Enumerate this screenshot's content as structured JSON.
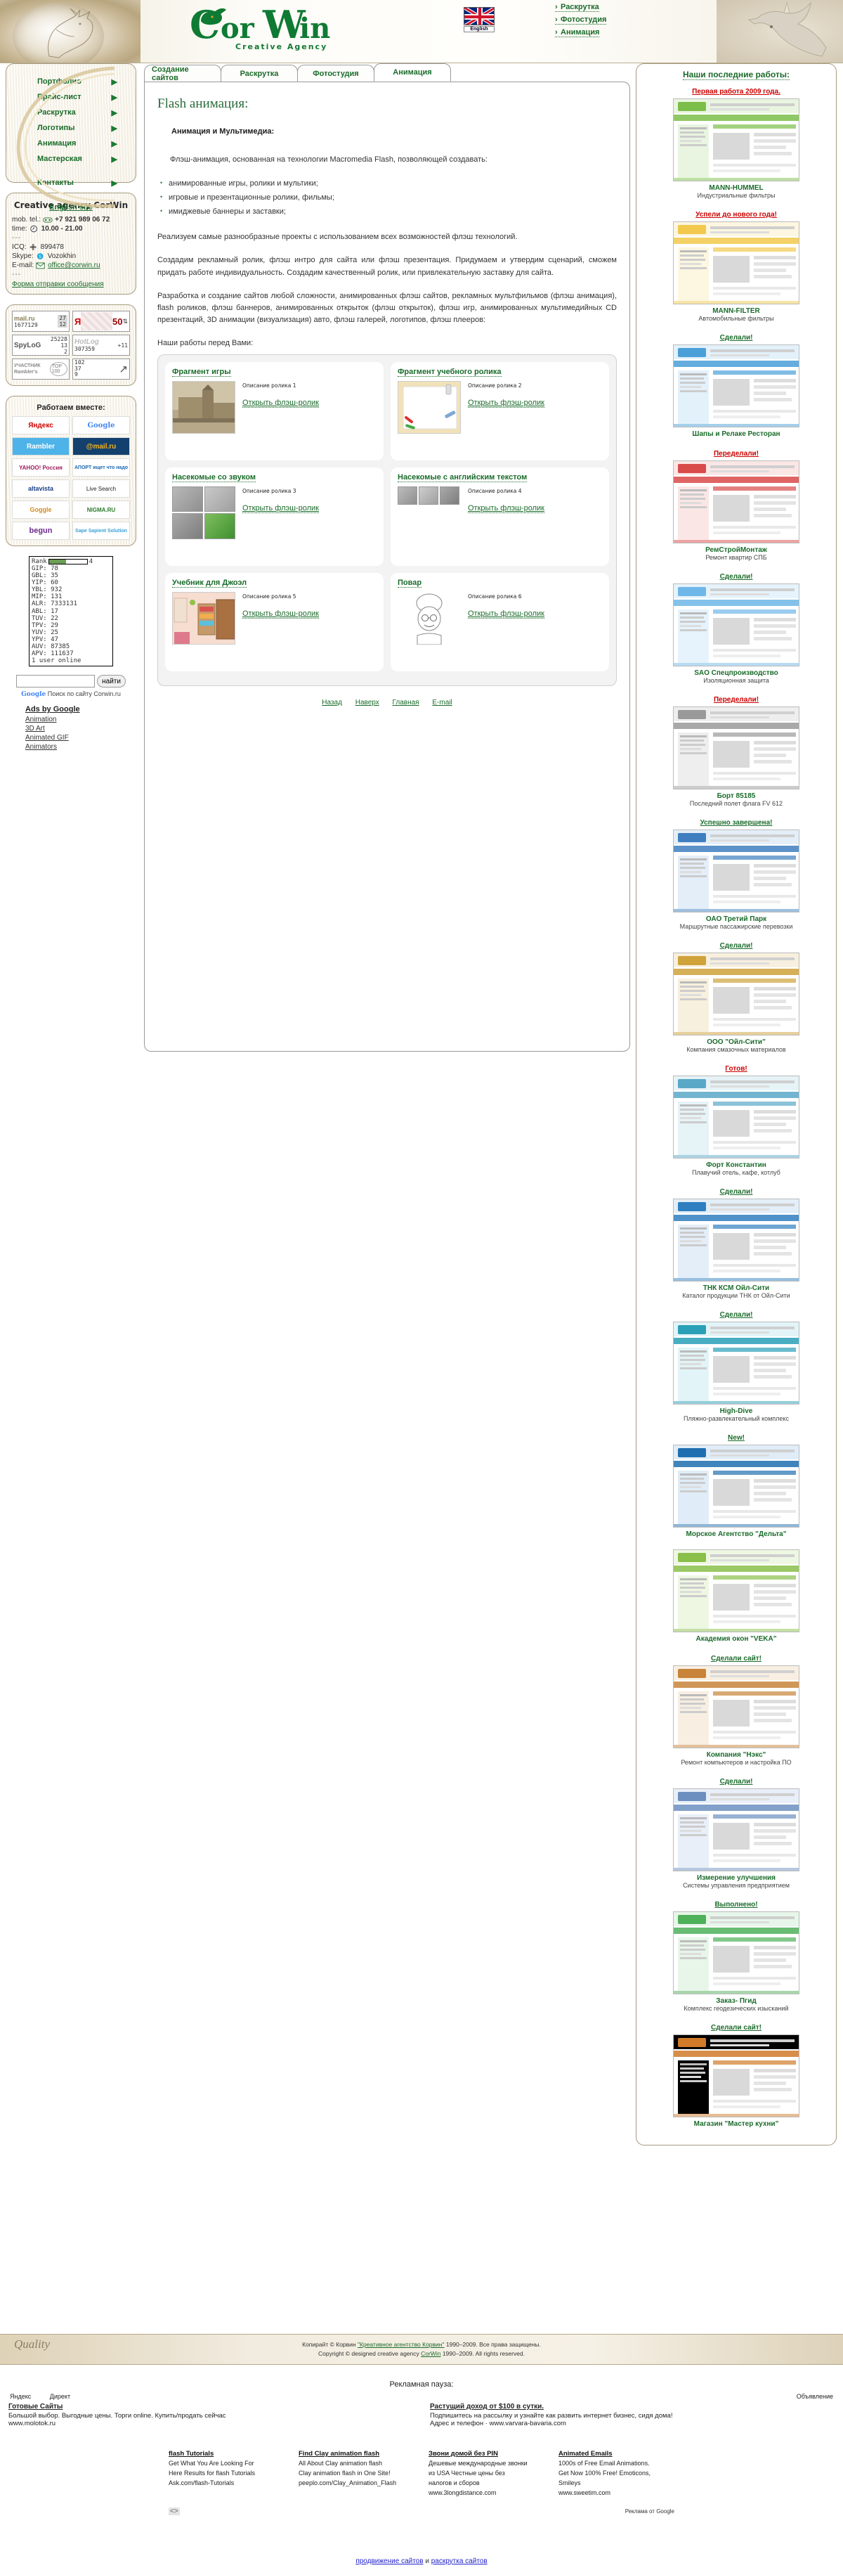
{
  "header": {
    "logo_text": "CorWin",
    "logo_tagline": "Creative Agency",
    "flag_label": "English",
    "nav": [
      {
        "label": "Раскрутка"
      },
      {
        "label": "Фотостудия"
      },
      {
        "label": "Анимация"
      }
    ]
  },
  "sidebar_left": {
    "nav": [
      {
        "label": "Портфолио"
      },
      {
        "label": "Прайс-лист"
      },
      {
        "label": "Раскрутка"
      },
      {
        "label": "Логотипы"
      },
      {
        "label": "Анимация"
      },
      {
        "label": "Мастерская"
      },
      {
        "label": "Контакты"
      }
    ],
    "english_site": "English site",
    "contacts": {
      "title": "Creative agency CorWin",
      "mob_label": "mob. tel.:",
      "mob_value": "+7 921 989 06 72",
      "time_label": "time:",
      "time_value": "10.00 - 21.00",
      "sep": "---",
      "icq_label": "ICQ:",
      "icq_value": "899478",
      "skype_label": "Skype:",
      "skype_value": "Vozokhin",
      "email_label": "E-mail:",
      "email_value": "office@corwin.ru",
      "form_link": "Форма отправки сообщения"
    },
    "counters": [
      {
        "name": "mail-ru-counter",
        "brand": "mail.ru",
        "sub": "1677129",
        "v1": "27",
        "v2": "12"
      },
      {
        "name": "yandex-counter",
        "brand": "Я",
        "sub": "",
        "v1": "50",
        "v2": ""
      },
      {
        "name": "spylog-counter",
        "brand": "SpyLoG",
        "sub": "",
        "v1": "25228",
        "v2": "13",
        "v3": "2"
      },
      {
        "name": "hotlog-counter",
        "brand": "HotLog",
        "sub": "307359",
        "v1": "+11",
        "v2": ""
      },
      {
        "name": "rambler-top100-counter",
        "brand": "УЧАСТНИК Rambler's",
        "sub": "TOP 100",
        "v1": "",
        "v2": ""
      },
      {
        "name": "liveinternet-counter",
        "brand": "",
        "sub": "",
        "v1": "102",
        "v2": "37",
        "v3": "9"
      }
    ],
    "partners": {
      "title": "Работаем вместе:",
      "logos": [
        {
          "label": "Яндекс"
        },
        {
          "label": "Google"
        },
        {
          "label": "Rambler"
        },
        {
          "label": "@mail.ru"
        },
        {
          "label": "YAHOO! Россия"
        },
        {
          "label": "АПОРТ ищет что надо"
        },
        {
          "label": "altavista"
        },
        {
          "label": "Live Search"
        },
        {
          "label": "Goggle"
        },
        {
          "label": "NIGMA.RU"
        },
        {
          "label": "begun"
        },
        {
          "label": "Sape Sapient Solution"
        }
      ]
    },
    "stats": {
      "rank_label": "Rank",
      "rank_value": "4",
      "rank_pct": 45,
      "rows": [
        {
          "k": "GIP:",
          "v": "78"
        },
        {
          "k": "GBL:",
          "v": "35"
        },
        {
          "k": "YIP:",
          "v": "60"
        },
        {
          "k": "YBL:",
          "v": "932"
        },
        {
          "k": "MIP:",
          "v": "131"
        },
        {
          "k": "ALR:",
          "v": "7333131"
        },
        {
          "k": "ABL:",
          "v": "17"
        },
        {
          "k": "TUV:",
          "v": "22"
        },
        {
          "k": "TPV:",
          "v": "29"
        },
        {
          "k": "YUV:",
          "v": "25"
        },
        {
          "k": "YPV:",
          "v": "47"
        },
        {
          "k": "AUV:",
          "v": "87385"
        },
        {
          "k": "APV:",
          "v": "111637"
        }
      ],
      "online": "1 user online"
    },
    "search": {
      "value": "",
      "placeholder": "",
      "button": "найти",
      "google_label": "Google",
      "caption": "Поиск по сайту Corwin.ru"
    },
    "ads": {
      "title": "Ads by Google",
      "links": [
        "Animation",
        "3D Art",
        "Animated GIF",
        "Animators"
      ]
    }
  },
  "main": {
    "tabs": [
      {
        "label": "Создание сайтов",
        "active": false
      },
      {
        "label": "Раскрутка",
        "active": false
      },
      {
        "label": "Фотостудия",
        "active": false
      },
      {
        "label": "Анимация",
        "active": true
      }
    ],
    "title": "Flash анимация:",
    "subtitle": "Анимация и Мультимедиа:",
    "intro": "Флэш-анимация, основанная на технологии Macromedia Flash, позволяющей создавать:",
    "features": [
      "анимированные игры, ролики и мультики;",
      "игровые и презентационные ролики, фильмы;",
      "имиджевые баннеры и заставки;"
    ],
    "p1": "Реализуем самые разнообразные проекты с использованием всех возможностей флэш технологий.",
    "p2": "Создадим рекламный ролик, флэш интро для сайта или флэш презентация. Придумаем и утвердим сценарий, сможем придать работе индивидуальность. Создадим качественный ролик, или привлекательную заставку для сайта.",
    "p3": "Разработка и создание сайтов любой сложности, анимированных флэш сайтов, рекламных мультфильмов (флэш анимация), flash роликов, флэш баннеров, анимированных открыток (флэш открыток), флэш игр, анимированных мультимедийных CD презентаций, 3D анимации (визуализация) авто, флэш галерей, логотипов, флэш плееров:",
    "works_label": "Наши работы перед Вами:",
    "works": [
      {
        "title": "Фрагмент игры",
        "desc": "Описание ролика 1",
        "link": "Открыть флэш-ролик",
        "thumb": "fortress-photo"
      },
      {
        "title": "Фрагмент учебного ролика",
        "desc": "Описание ролика 2",
        "link": "Открыть флэш-ролик",
        "thumb": "whiteboard-illustration"
      },
      {
        "title": "Насекомые со звуком",
        "desc": "Описание ролика 3",
        "link": "Открыть флэш-ролик",
        "thumb": "insects-grid"
      },
      {
        "title": "Насекомые с английским текстом",
        "desc": "Описание ролика 4",
        "link": "Открыть флэш-ролик",
        "thumb": "insects-row"
      },
      {
        "title": "Учебник для Джоэл",
        "desc": "Описание ролика 5",
        "link": "Открыть флэш-ролик",
        "thumb": "classroom-illustration"
      },
      {
        "title": "Повар",
        "desc": "Описание ролика 6",
        "link": "Открыть флэш-ролик",
        "thumb": "chef-sketch"
      }
    ],
    "bottom_nav": [
      {
        "label": "Назад"
      },
      {
        "label": "Наверх"
      },
      {
        "label": "Главная"
      },
      {
        "label": "E-mail"
      }
    ]
  },
  "sidebar_right": {
    "title": "Наши последние работы:",
    "items": [
      {
        "badge": "Первая работа 2009 года.",
        "badge_color": "#cc0000",
        "name": "MANN-HUMMEL",
        "desc": "Индустриальные фильтры",
        "thumb": "site-screenshot-green"
      },
      {
        "badge": "Успели до нового года!",
        "badge_color": "#cc0000",
        "name": "MANN-FILTER",
        "desc": "Автомобильные фильтры",
        "thumb": "site-screenshot-yellow"
      },
      {
        "badge": "Сделали!",
        "badge_color": "#1a6b2a",
        "name": "Шапы и Релаке Ресторан",
        "desc": "",
        "thumb": "site-screenshot-blue"
      },
      {
        "badge": "Переделали!",
        "badge_color": "#cc0000",
        "name": "РемСтройМонтаж",
        "desc": "Ремонт квартир СПБ",
        "thumb": "site-screenshot-red"
      },
      {
        "badge": "Сделали!",
        "badge_color": "#1a6b2a",
        "name": "SAO Спецпроизводство",
        "desc": "Изоляционная защита",
        "thumb": "site-screenshot-lightblue"
      },
      {
        "badge": "Переделали!",
        "badge_color": "#cc0000",
        "name": "Борт 85185",
        "desc": "Последний полет флага FV 612",
        "thumb": "site-screenshot-grey"
      },
      {
        "badge": "Успешно завершена!",
        "badge_color": "#1a6b2a",
        "name": "ОАО Третий Парк",
        "desc": "Маршрутные пассажирские перевозки",
        "thumb": "site-screenshot-bus"
      },
      {
        "badge": "Сделали!",
        "badge_color": "#1a6b2a",
        "name": "ООО \"Ойл-Сити\"",
        "desc": "Компания смазочных материалов",
        "thumb": "site-screenshot-oil"
      },
      {
        "badge": "Готов!",
        "badge_color": "#cc0000",
        "name": "Форт Константин",
        "desc": "Плавучий отель, кафе, котлуб",
        "thumb": "site-screenshot-fort"
      },
      {
        "badge": "Сделали!",
        "badge_color": "#1a6b2a",
        "name": "ТНК КСМ Ойл-Сити",
        "desc": "Каталог продукции ТНК от Ойл-Сити",
        "thumb": "site-screenshot-tnk"
      },
      {
        "badge": "Сделали!",
        "badge_color": "#1a6b2a",
        "name": "High-Dive",
        "desc": "Пляжно-развлекательный комплекс",
        "thumb": "site-screenshot-dive"
      },
      {
        "badge": "New!",
        "badge_color": "#1a6b2a",
        "name": "Морское Агентство \"Дельта\"",
        "desc": "",
        "thumb": "site-screenshot-sea"
      },
      {
        "badge": "",
        "badge_color": "#1a6b2a",
        "name": "Академия окон \"VEKA\"",
        "desc": "",
        "thumb": "site-screenshot-veka"
      },
      {
        "badge": "Сделали сайт!",
        "badge_color": "#1a6b2a",
        "name": "Компания \"Нэкс\"",
        "desc": "Ремонт компьютеров и настройка ПО",
        "thumb": "site-screenshot-nex"
      },
      {
        "badge": "Сделали!",
        "badge_color": "#1a6b2a",
        "name": "Измерение улучшения",
        "desc": "Системы управления предприятием",
        "thumb": "site-screenshot-sys"
      },
      {
        "badge": "Выполнено!",
        "badge_color": "#1a6b2a",
        "name": "Заказ- Пгид",
        "desc": "Комплекс геодезических изысканий",
        "thumb": "site-screenshot-geo"
      },
      {
        "badge": "Сделали сайт!",
        "badge_color": "#1a6b2a",
        "name": "Магазин \"Мастер кухни\"",
        "desc": "",
        "thumb": "site-screenshot-kitchen"
      }
    ]
  },
  "footer": {
    "copyright_ru_prefix": "Копирайт © Корвин ",
    "copyright_ru_link": "\"Креативное агентство Корвин\"",
    "copyright_ru_suffix": " 1990–2009. Все права защищены.",
    "copyright_en_prefix": "Copyright © designed creative agency ",
    "copyright_en_link": "CorWin",
    "copyright_en_suffix": " 1990–2009. All rights reserved.",
    "quality_logo": "Qualitу"
  },
  "ads_footer": {
    "pause_title": "Рекламная пауза:",
    "yandex_label": "Яндекс",
    "direct_label": "Директ",
    "announce_label": "Объявление",
    "blocks": [
      {
        "title": "Готовые Сайты",
        "desc": "Большой выбор. Выгодные цены. Торги online. Купить/продать сейчас",
        "url": "www.molotok.ru"
      },
      {
        "title": "Растущий доход от $100 в сутки.",
        "desc": "Подпишитесь на рассылку и узнайте как развить интернет бизнес, сидя дома!",
        "url": "Адрес и телефон  ·  www.varvara-bavaria.com"
      }
    ],
    "google_ads": [
      {
        "title": "flash Tutorials",
        "lines": [
          "Get What You Are Looking For",
          "Here Results for flash Tutorials",
          "Ask.com/flash-Tutorials"
        ]
      },
      {
        "title": "Find Clay animation flash",
        "lines": [
          "All About Clay animation flash",
          "Clay animation flash in One Site!",
          "peeplo.com/Clay_Animation_Flash"
        ]
      },
      {
        "title": "Звони домой без PIN",
        "lines": [
          "Дешевые международные звонки",
          "из USA Честные цены без",
          "налогов и сборов",
          "www.3longdistance.com"
        ]
      },
      {
        "title": "Animated Emails",
        "lines": [
          "1000s of Free Email Animations.",
          "Get Now 100% Free! Emoticons,",
          "Smileys",
          "www.sweetim.com"
        ]
      }
    ],
    "google_by": "Реклама от Google",
    "arrows": "<>",
    "bottom_links": [
      {
        "label": "продвижение сайтов"
      },
      {
        "label": "и",
        "plain": true
      },
      {
        "label": "раскрутка сайтов"
      }
    ]
  }
}
